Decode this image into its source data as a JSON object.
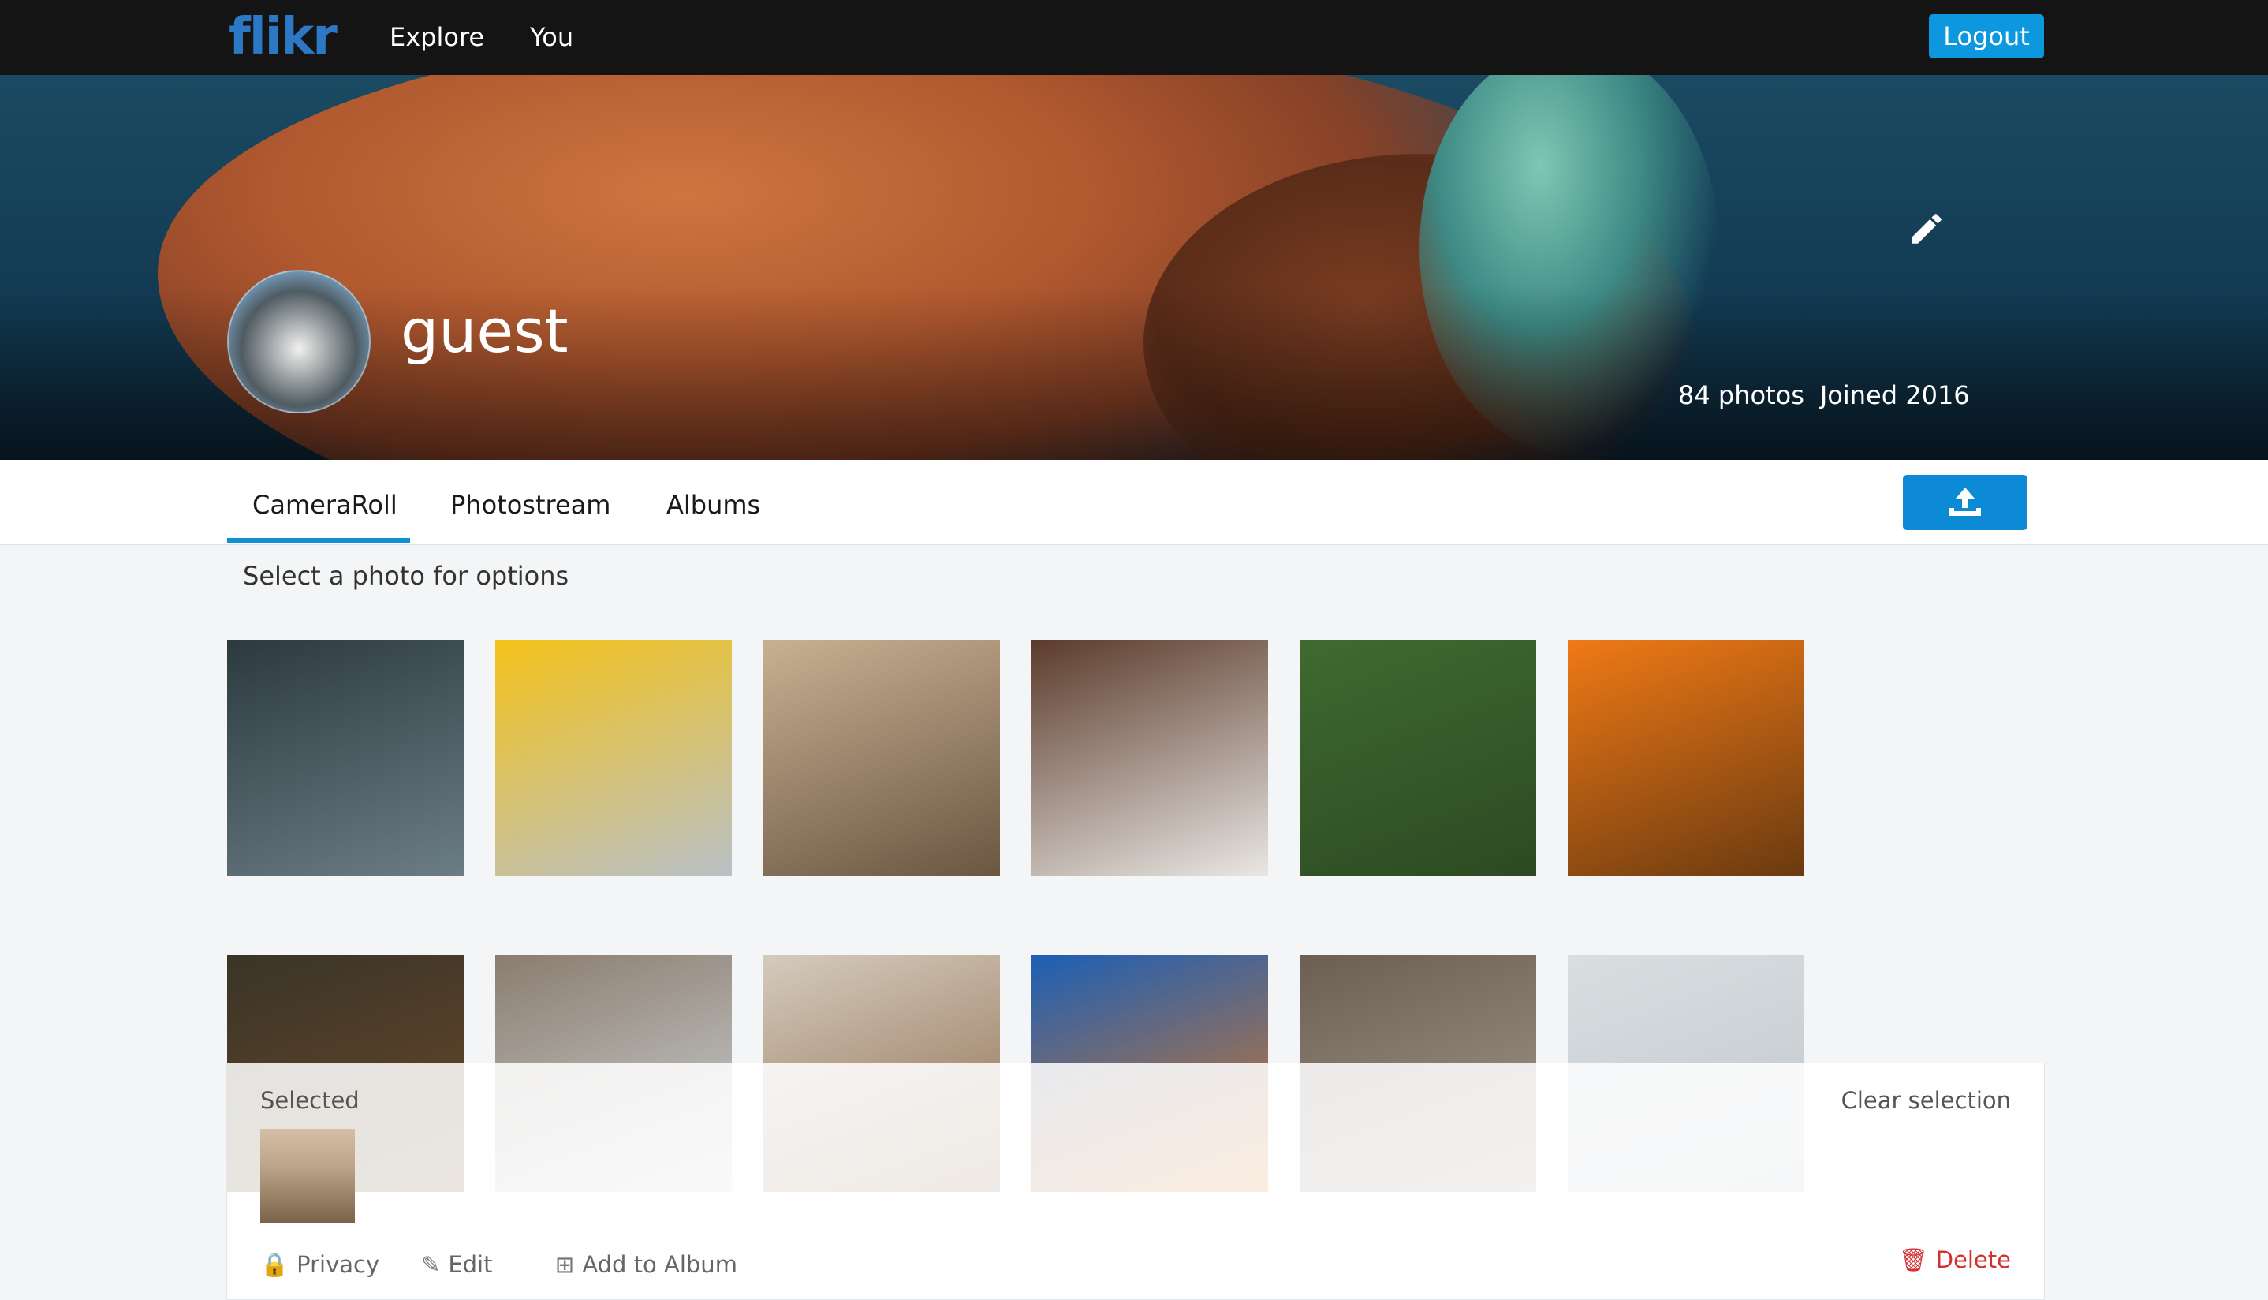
{
  "header": {
    "logo_left": "fl",
    "logo_right": "ikr",
    "nav": [
      "Explore",
      "You"
    ],
    "logout_label": "Logout"
  },
  "profile": {
    "username": "guest",
    "photo_count": "84 photos",
    "joined": "Joined 2016"
  },
  "tabs": [
    "CameraRoll",
    "Photostream",
    "Albums"
  ],
  "active_tab": "CameraRoll",
  "hint": "Select a photo for options",
  "photos": [
    {
      "name": "coffee-pour-over",
      "c1": "#2c3a3f",
      "c2": "#6b7d86"
    },
    {
      "name": "sunflower",
      "c1": "#f4c21a",
      "c2": "#b9c1c6"
    },
    {
      "name": "barren-trees",
      "c1": "#c9b092",
      "c2": "#6a5642"
    },
    {
      "name": "child-reading-bible",
      "c1": "#5b3b2b",
      "c2": "#e9e7e4"
    },
    {
      "name": "aerial-green-valley",
      "c1": "#3f6a30",
      "c2": "#2c4a22"
    },
    {
      "name": "orange-flower-droplets",
      "c1": "#f07a16",
      "c2": "#6a3a10"
    },
    {
      "name": "fox-in-forest",
      "c1": "#3a3428",
      "c2": "#6b4a2a"
    },
    {
      "name": "bridge-between-buildings",
      "c1": "#8b7d6f",
      "c2": "#cfd5d8"
    },
    {
      "name": "sunset-cliff",
      "c1": "#d4cbbd",
      "c2": "#8d6a4c"
    },
    {
      "name": "orange-jellyfish",
      "c1": "#1d5fb5",
      "c2": "#e07a22"
    },
    {
      "name": "deer-in-woods",
      "c1": "#6c5e52",
      "c2": "#a69b90"
    },
    {
      "name": "misty-landscape",
      "c1": "#d9dee1",
      "c2": "#bfc6ca"
    }
  ],
  "selection": {
    "label": "Selected",
    "clear_label": "Clear selection",
    "actions": [
      "Privacy",
      "Edit",
      "Add to Album"
    ],
    "delete_label": "Delete"
  },
  "colors": {
    "accent": "#0c97de",
    "topbar": "#141414",
    "delete": "#d32f2f"
  }
}
